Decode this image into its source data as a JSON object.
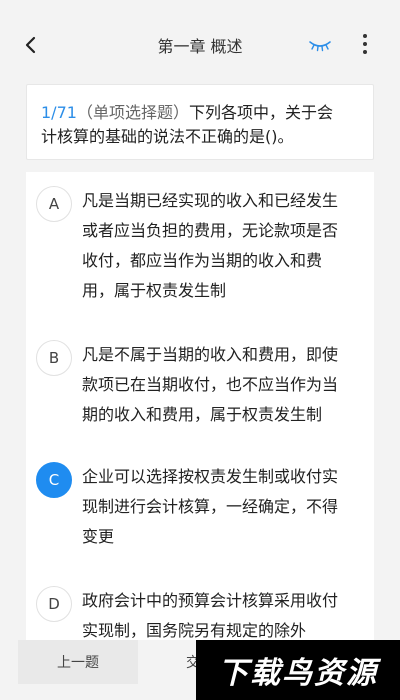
{
  "header": {
    "title": "第一章 概述",
    "back_icon": "back-arrow-icon",
    "eye_icon": "eye-closed-icon",
    "more_icon": "more-vertical-icon",
    "accent": "#2c8ee8"
  },
  "question": {
    "number": "1/71",
    "type": "（单项选择题）",
    "stem_line1": "下列各项中，关于会",
    "stem_line2": "计核算的基础的说法不正确的是()。"
  },
  "options": [
    {
      "letter": "A",
      "lines": [
        "凡是当期已经实现的收入和已经发生",
        "或者应当负担的费用，无论款项是否",
        "收付，都应当作为当期的收入和费",
        "用，属于权责发生制"
      ],
      "selected": false
    },
    {
      "letter": "B",
      "lines": [
        "凡是不属于当期的收入和费用，即使",
        "款项已在当期收付，也不应当作为当",
        "期的收入和费用，属于权责发生制"
      ],
      "selected": false
    },
    {
      "letter": "C",
      "lines": [
        "企业可以选择按权责发生制或收付实",
        "现制进行会计核算，一经确定，不得",
        "变更"
      ],
      "selected": true
    },
    {
      "letter": "D",
      "lines": [
        "政府会计中的预算会计核算采用收付",
        "实现制，国务院另有规定的除外"
      ],
      "selected": false
    }
  ],
  "footer": {
    "prev_label": "上一题",
    "submit_label": "交"
  },
  "watermark": {
    "text": "下载鸟资源"
  },
  "colors": {
    "selected": "#1f8cf0",
    "background": "#f3f3f3"
  }
}
